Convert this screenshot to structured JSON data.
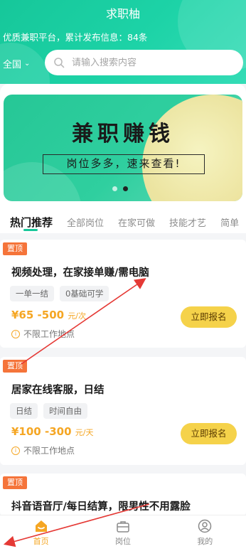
{
  "app_title": "求职柚",
  "subtitle": "优质兼职平台，累计发布信息：84条",
  "region": "全国",
  "search": {
    "placeholder": "请输入搜索内容"
  },
  "banner": {
    "title": "兼职赚钱",
    "slogan": "岗位多多，速来查看!"
  },
  "tabs": [
    "热门推荐",
    "全部岗位",
    "在家可做",
    "技能才艺",
    "简单"
  ],
  "jobs": [
    {
      "pin": "置顶",
      "title": "视频处理，在家接单赚/需电脑",
      "tags": [
        "一单一结",
        "0基础可学"
      ],
      "price": "¥65 -500",
      "unit": "元/次",
      "location": "不限工作地点",
      "apply": "立即报名"
    },
    {
      "pin": "置顶",
      "title": "居家在线客服，日结",
      "tags": [
        "日结",
        "时间自由"
      ],
      "price": "¥100 -300",
      "unit": "元/天",
      "location": "不限工作地点",
      "apply": "立即报名"
    },
    {
      "pin": "置顶",
      "title": "抖音语音厅/每日结算，限男性不用露脸"
    }
  ],
  "nav": [
    {
      "label": "首页",
      "icon": "home-icon",
      "active": true
    },
    {
      "label": "岗位",
      "icon": "briefcase-icon",
      "active": false
    },
    {
      "label": "我的",
      "icon": "user-icon",
      "active": false
    }
  ],
  "colors": {
    "brand_green": "#16c79a",
    "price_orange": "#f5a623",
    "pin_orange": "#f5743a",
    "apply_yellow": "#f5d24a",
    "annotation_red": "#e53935"
  }
}
